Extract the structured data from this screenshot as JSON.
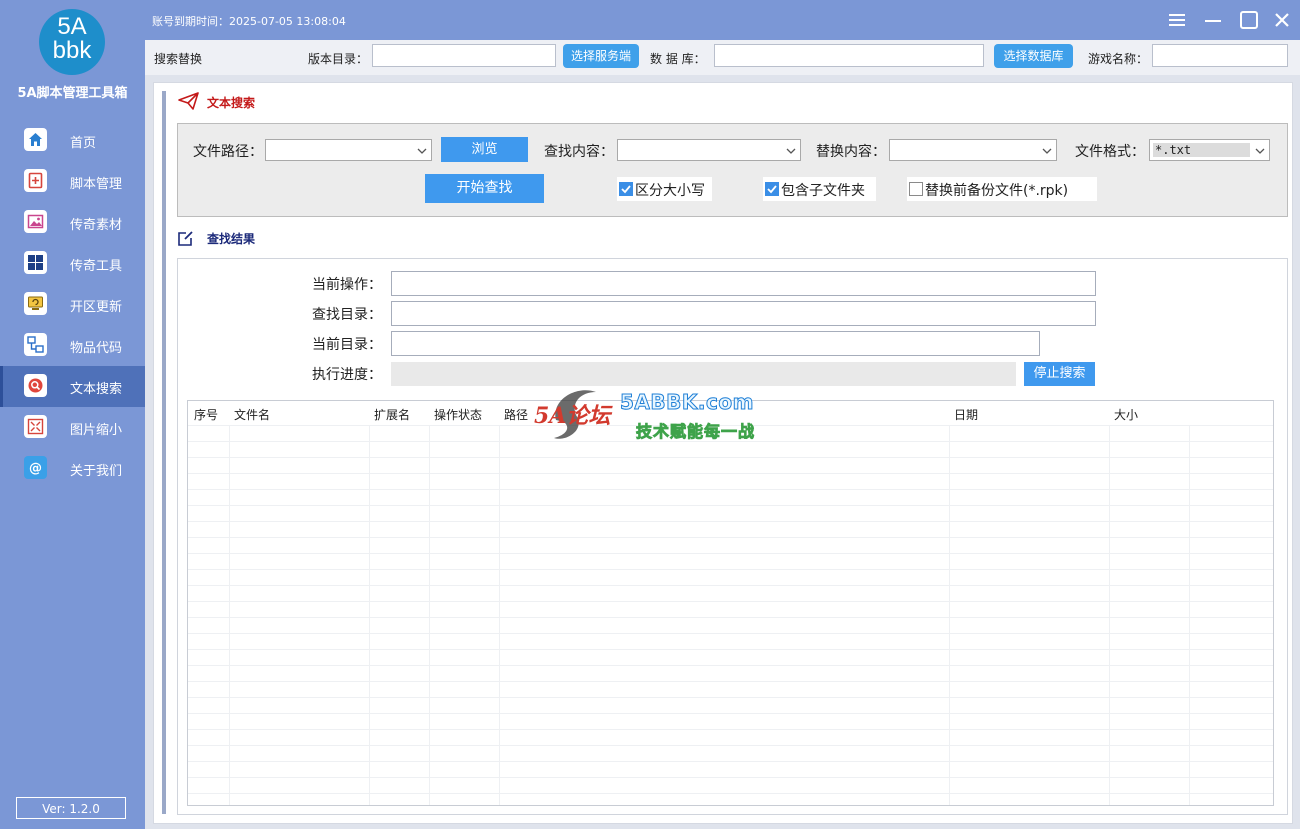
{
  "sidebar": {
    "logo_line1": "5A",
    "logo_line2": "bbk",
    "app_title": "5A脚本管理工具箱",
    "items": [
      {
        "label": "首页",
        "icon": "home-icon"
      },
      {
        "label": "脚本管理",
        "icon": "script-add-icon"
      },
      {
        "label": "传奇素材",
        "icon": "image-icon"
      },
      {
        "label": "传奇工具",
        "icon": "grid-icon"
      },
      {
        "label": "开区更新",
        "icon": "refresh-monitor-icon"
      },
      {
        "label": "物品代码",
        "icon": "network-icon"
      },
      {
        "label": "文本搜索",
        "icon": "search-icon",
        "active": true
      },
      {
        "label": "图片缩小",
        "icon": "shrink-icon"
      },
      {
        "label": "关于我们",
        "icon": "at-icon"
      }
    ],
    "version": "Ver: 1.2.0"
  },
  "titlebar": {
    "expire_text": "账号到期时间：2025-07-05 13:08:04"
  },
  "toolbar": {
    "section": "搜索替换",
    "version_dir_label": "版本目录：",
    "version_dir_value": "",
    "select_server_btn": "选择服务端",
    "database_label": "数 据 库：",
    "database_value": "",
    "select_db_btn": "选择数据库",
    "game_name_label": "游戏名称：",
    "game_name_value": ""
  },
  "text_search": {
    "title": "文本搜索",
    "file_path_label": "文件路径：",
    "file_path_value": "",
    "browse_btn": "浏览",
    "find_label": "查找内容：",
    "find_value": "",
    "replace_label": "替换内容：",
    "replace_value": "",
    "format_label": "文件格式：",
    "format_value": "*.txt",
    "start_btn": "开始查找",
    "case_sensitive": {
      "label": "区分大小写",
      "checked": true
    },
    "include_subfolders": {
      "label": "包含子文件夹",
      "checked": true
    },
    "backup": {
      "label": "替换前备份文件(*.rpk)",
      "checked": false
    }
  },
  "results": {
    "title": "查找结果",
    "current_op_label": "当前操作：",
    "current_op_value": "",
    "search_dir_label": "查找目录：",
    "search_dir_value": "",
    "current_dir_label": "当前目录：",
    "current_dir_value": "",
    "progress_label": "执行进度：",
    "progress_value": 0,
    "stop_btn": "停止搜索",
    "columns": [
      "序号",
      "文件名",
      "扩展名",
      "操作状态",
      "路径",
      "日期",
      "大小"
    ],
    "rows": []
  },
  "watermark": {
    "logo": "5A论坛",
    "site": "5ABBK.com",
    "slogan": "技术赋能每一战"
  },
  "colors": {
    "sidebar_bg": "#7b97d6",
    "active_item_bg": "#4f71b9",
    "button_blue": "#3f99ee",
    "section_title_red": "#c41a1a",
    "section_title_navy": "#1c2a7a"
  }
}
